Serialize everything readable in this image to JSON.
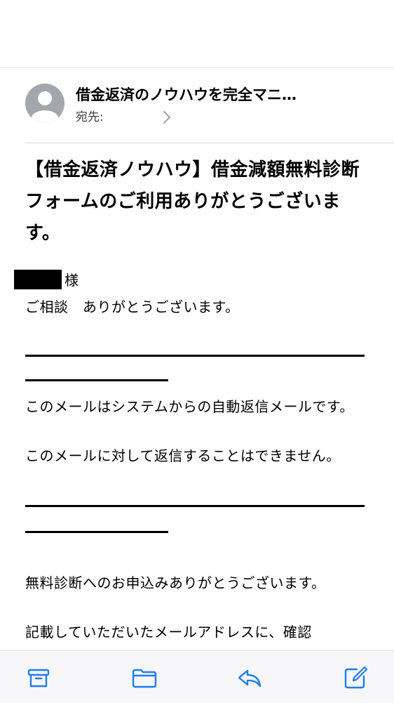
{
  "header": {
    "sender": "借金返済のノウハウを完全マニ…",
    "to_label": "宛先:"
  },
  "email": {
    "subject": "【借金返済ノウハウ】借金減額無料診断フォームのご利用ありがとうございます。",
    "salutation_suffix": "様",
    "greeting": "ご相談　ありがとうございます。",
    "notice_line1": "このメールはシステムからの自動返信メールです。",
    "notice_line2": "このメールに対して返信することはできません。",
    "body_line1": "無料診断へのお申込みありがとうございます。",
    "body_line2": "記載していただいたメールアドレスに、確認"
  },
  "toolbar": {
    "items": [
      "archive-icon",
      "folder-icon",
      "reply-icon",
      "compose-icon"
    ]
  },
  "colors": {
    "accent": "#1f7cf2",
    "avatar_bg": "#a3a6ad",
    "secondary_text": "#3c3c43"
  }
}
